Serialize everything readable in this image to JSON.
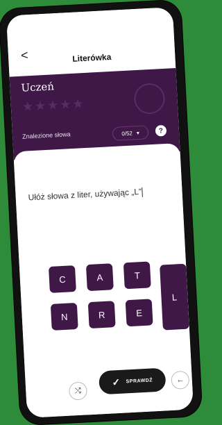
{
  "header": {
    "back_icon": "back-icon",
    "title": "Literówka"
  },
  "level": {
    "name": "Uczeń",
    "stars_total": 5,
    "stars_filled": 0
  },
  "found_words": {
    "label": "Znalezione słowa",
    "count": "0/52"
  },
  "prompt": {
    "text": "Ułóż słowa z liter, używając „L”"
  },
  "tiles": [
    {
      "letter": "C"
    },
    {
      "letter": "A"
    },
    {
      "letter": "T"
    },
    {
      "letter": "L"
    },
    {
      "letter": "N"
    },
    {
      "letter": "R"
    },
    {
      "letter": "E"
    }
  ],
  "actions": {
    "shuffle_icon": "shuffle-icon",
    "check_label": "SPRAWDŹ",
    "backspace_icon": "backspace-icon"
  },
  "colors": {
    "brand_purple": "#3f1848",
    "background_green": "#2e8b3a",
    "button_dark": "#1a1a1a"
  }
}
